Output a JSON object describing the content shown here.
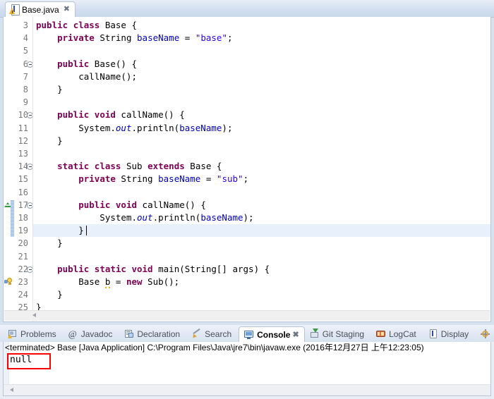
{
  "editor": {
    "tab": {
      "label": "Base.java",
      "close_glyph": "✖",
      "icon": "java-file-warning-icon"
    },
    "first_visible_line": 3,
    "current_line": 19,
    "lines": [
      {
        "num": "3",
        "indent": 0,
        "fold": false,
        "tokens": [
          {
            "t": "public",
            "c": "kw"
          },
          {
            "t": " ",
            "c": "pl"
          },
          {
            "t": "class",
            "c": "kw"
          },
          {
            "t": " Base {",
            "c": "pl"
          }
        ]
      },
      {
        "num": "4",
        "indent": 0,
        "fold": false,
        "tokens": [
          {
            "t": "    ",
            "c": "pl"
          },
          {
            "t": "private",
            "c": "kw"
          },
          {
            "t": " String ",
            "c": "pl"
          },
          {
            "t": "baseName",
            "c": "fld"
          },
          {
            "t": " = ",
            "c": "pl"
          },
          {
            "t": "\"base\"",
            "c": "str"
          },
          {
            "t": ";",
            "c": "pl"
          }
        ]
      },
      {
        "num": "5",
        "indent": 0,
        "fold": false,
        "tokens": []
      },
      {
        "num": "6",
        "indent": 0,
        "fold": true,
        "tokens": [
          {
            "t": "    ",
            "c": "pl"
          },
          {
            "t": "public",
            "c": "kw"
          },
          {
            "t": " Base() {",
            "c": "pl"
          }
        ]
      },
      {
        "num": "7",
        "indent": 0,
        "fold": false,
        "tokens": [
          {
            "t": "        callName();",
            "c": "pl"
          }
        ]
      },
      {
        "num": "8",
        "indent": 0,
        "fold": false,
        "tokens": [
          {
            "t": "    }",
            "c": "pl"
          }
        ]
      },
      {
        "num": "9",
        "indent": 0,
        "fold": false,
        "tokens": []
      },
      {
        "num": "10",
        "indent": 0,
        "fold": true,
        "tokens": [
          {
            "t": "    ",
            "c": "pl"
          },
          {
            "t": "public",
            "c": "kw"
          },
          {
            "t": " ",
            "c": "pl"
          },
          {
            "t": "void",
            "c": "kw"
          },
          {
            "t": " callName() {",
            "c": "pl"
          }
        ]
      },
      {
        "num": "11",
        "indent": 0,
        "fold": false,
        "tokens": [
          {
            "t": "        System.",
            "c": "pl"
          },
          {
            "t": "out",
            "c": "stat"
          },
          {
            "t": ".println(",
            "c": "pl"
          },
          {
            "t": "baseName",
            "c": "fld"
          },
          {
            "t": ");",
            "c": "pl"
          }
        ]
      },
      {
        "num": "12",
        "indent": 0,
        "fold": false,
        "tokens": [
          {
            "t": "    }",
            "c": "pl"
          }
        ]
      },
      {
        "num": "13",
        "indent": 0,
        "fold": false,
        "tokens": []
      },
      {
        "num": "14",
        "indent": 0,
        "fold": true,
        "tokens": [
          {
            "t": "    ",
            "c": "pl"
          },
          {
            "t": "static",
            "c": "kw"
          },
          {
            "t": " ",
            "c": "pl"
          },
          {
            "t": "class",
            "c": "kw"
          },
          {
            "t": " Sub ",
            "c": "pl"
          },
          {
            "t": "extends",
            "c": "kw"
          },
          {
            "t": " Base {",
            "c": "pl"
          }
        ]
      },
      {
        "num": "15",
        "indent": 0,
        "fold": false,
        "tokens": [
          {
            "t": "        ",
            "c": "pl"
          },
          {
            "t": "private",
            "c": "kw"
          },
          {
            "t": " String ",
            "c": "pl"
          },
          {
            "t": "baseName",
            "c": "fld"
          },
          {
            "t": " = ",
            "c": "pl"
          },
          {
            "t": "\"sub\"",
            "c": "str"
          },
          {
            "t": ";",
            "c": "pl"
          }
        ]
      },
      {
        "num": "16",
        "indent": 0,
        "fold": false,
        "tokens": []
      },
      {
        "num": "17",
        "indent": 0,
        "fold": true,
        "marker": "override-triangle",
        "tokens": [
          {
            "t": "        ",
            "c": "pl"
          },
          {
            "t": "public",
            "c": "kw"
          },
          {
            "t": " ",
            "c": "pl"
          },
          {
            "t": "void",
            "c": "kw"
          },
          {
            "t": " callName() {",
            "c": "pl"
          }
        ]
      },
      {
        "num": "18",
        "indent": 0,
        "fold": false,
        "tokens": [
          {
            "t": "            System.",
            "c": "pl"
          },
          {
            "t": "out",
            "c": "stat"
          },
          {
            "t": ".println(",
            "c": "pl"
          },
          {
            "t": "baseName",
            "c": "fld"
          },
          {
            "t": ");",
            "c": "pl"
          }
        ]
      },
      {
        "num": "19",
        "indent": 0,
        "fold": false,
        "highlight": true,
        "tokens": [
          {
            "t": "        }",
            "c": "pl"
          }
        ]
      },
      {
        "num": "20",
        "indent": 0,
        "fold": false,
        "tokens": [
          {
            "t": "    }",
            "c": "pl"
          }
        ]
      },
      {
        "num": "21",
        "indent": 0,
        "fold": false,
        "tokens": []
      },
      {
        "num": "22",
        "indent": 0,
        "fold": true,
        "tokens": [
          {
            "t": "    ",
            "c": "pl"
          },
          {
            "t": "public",
            "c": "kw"
          },
          {
            "t": " ",
            "c": "pl"
          },
          {
            "t": "static",
            "c": "kw"
          },
          {
            "t": " ",
            "c": "pl"
          },
          {
            "t": "void",
            "c": "kw"
          },
          {
            "t": " main(String[] args) {",
            "c": "pl"
          }
        ]
      },
      {
        "num": "23",
        "indent": 0,
        "fold": false,
        "marker": "warning-bulb",
        "tokens": [
          {
            "t": "        Base ",
            "c": "pl"
          },
          {
            "t": "b",
            "c": "pl warnu"
          },
          {
            "t": " = ",
            "c": "pl"
          },
          {
            "t": "new",
            "c": "kw"
          },
          {
            "t": " Sub();",
            "c": "pl"
          }
        ]
      },
      {
        "num": "24",
        "indent": 0,
        "fold": false,
        "tokens": [
          {
            "t": "    }",
            "c": "pl"
          }
        ]
      },
      {
        "num": "25",
        "indent": 0,
        "fold": false,
        "tokens": [
          {
            "t": "}",
            "c": "pl"
          }
        ]
      }
    ]
  },
  "bottom_panel": {
    "tabs": [
      {
        "label": "Problems",
        "icon": "problems-icon",
        "active": false
      },
      {
        "label": "Javadoc",
        "icon": "at-sign-icon",
        "active": false
      },
      {
        "label": "Declaration",
        "icon": "declaration-icon",
        "active": false
      },
      {
        "label": "Search",
        "icon": "search-pen-icon",
        "active": false
      },
      {
        "label": "Console",
        "icon": "console-icon",
        "active": true,
        "close_glyph": "✖"
      },
      {
        "label": "Git Staging",
        "icon": "git-staging-icon",
        "active": false
      },
      {
        "label": "LogCat",
        "icon": "logcat-icon",
        "active": false
      },
      {
        "label": "Display",
        "icon": "display-icon",
        "active": false
      },
      {
        "label": "Debug",
        "icon": "debug-icon",
        "active": false
      }
    ],
    "console": {
      "status_line": "<terminated> Base [Java Application] C:\\Program Files\\Java\\jre7\\bin\\javaw.exe (2016年12月27日 上午12:23:05)",
      "output": "null",
      "annotation_color": "#ff0000"
    }
  },
  "colors": {
    "keyword": "#7f0055",
    "string": "#2a00ff",
    "field": "#0000c0",
    "static_field": "#0000c0",
    "plain": "#000000",
    "line_number": "#787878",
    "current_line_bg": "#e8f1fb",
    "change_bar": "#8fb8e8",
    "tab_bar_bg": "#d3dff0"
  }
}
